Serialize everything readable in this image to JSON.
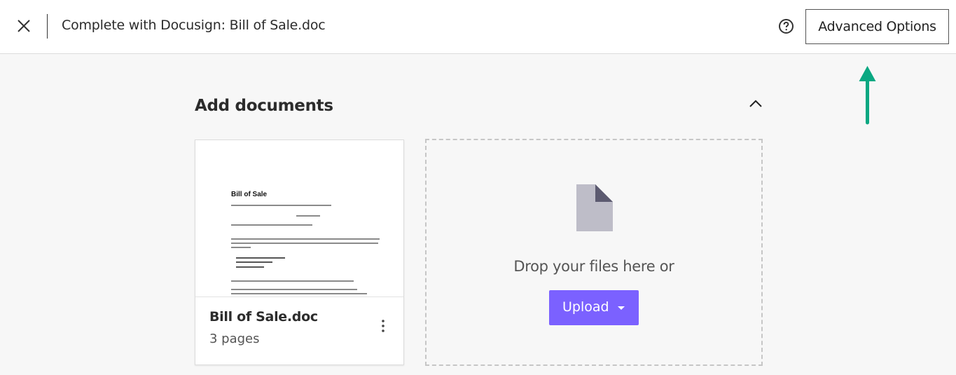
{
  "header": {
    "title": "Complete with Docusign: Bill of Sale.doc",
    "close_icon": "close-icon",
    "help_icon": "help-circle-icon",
    "advanced_options_label": "Advanced Options"
  },
  "section": {
    "title": "Add documents",
    "collapse_icon": "chevron-up-icon"
  },
  "document": {
    "name": "Bill of Sale.doc",
    "pages": "3 pages",
    "thumbnail_title": "Bill of Sale",
    "menu_icon": "more-vertical-icon"
  },
  "drop_zone": {
    "file_icon": "file-icon",
    "text": "Drop your files here or",
    "upload_label": "Upload",
    "upload_caret_icon": "caret-down-icon"
  },
  "colors": {
    "accent": "#7b61ff",
    "annotation_arrow": "#0aa882"
  }
}
